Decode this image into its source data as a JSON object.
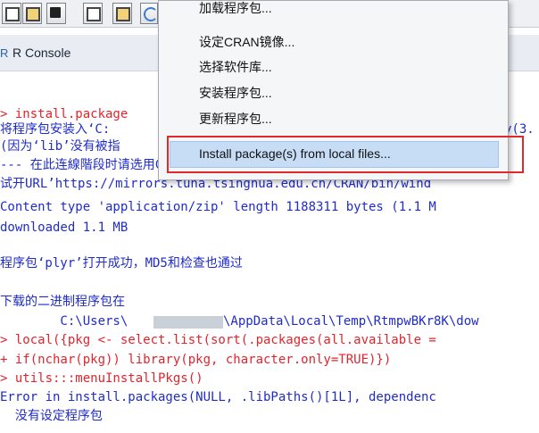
{
  "tab": {
    "title": "R Console"
  },
  "menu": {
    "items": [
      "加载程序包...",
      "设定CRAN镜像...",
      "选择软件库...",
      "安装程序包...",
      "更新程序包...",
      "Install package(s) from local files..."
    ]
  },
  "console": {
    "lines": [
      {
        "text": "> install.package",
        "color": "red"
      },
      {
        "text": "将程序包安装入‘C:",
        "color": "blue"
      },
      {
        "text": "y(3.",
        "color": "blue"
      },
      {
        "text": "(因为‘lib’没有被指",
        "color": "blue"
      },
      {
        "text": "--- 在此连線階段时请选用CRAN的镜子 ---",
        "color": "blue"
      },
      {
        "text": "试开URL’https://mirrors.tuna.tsinghua.edu.cn/CRAN/bin/wind",
        "color": "blue"
      },
      {
        "text": "Content type 'application/zip' length 1188311 bytes (1.1 M",
        "color": "blue"
      },
      {
        "text": "downloaded 1.1 MB",
        "color": "blue"
      },
      {
        "text": "程序包‘plyr’打开成功，MD5和检查也通过",
        "color": "blue"
      },
      {
        "text": "下载的二进制程序包在",
        "color": "blue"
      },
      {
        "text": "        C:\\Users\\",
        "color": "blue"
      },
      {
        "text": "\\AppData\\Local\\Temp\\RtmpwBKr8K\\dow",
        "color": "blue"
      },
      {
        "text": "> local({pkg <- select.list(sort(.packages(all.available =",
        "color": "red"
      },
      {
        "text": "+ if(nchar(pkg)) library(pkg, character.only=TRUE)})",
        "color": "red"
      },
      {
        "text": "> utils:::menuInstallPkgs()",
        "color": "red"
      },
      {
        "text": "Error in install.packages(NULL, .libPaths()[1L], dependenc",
        "color": "blue"
      },
      {
        "text": "  没有设定程序包",
        "color": "blue"
      }
    ]
  },
  "colors": {
    "red": "#e2242c",
    "blue": "#1f2cc9",
    "highlight": "#c7dcf5"
  },
  "icons": [
    "copy-icon",
    "paste-icon",
    "save-icon",
    "copy-icon",
    "paste-icon",
    "refresh-icon"
  ]
}
